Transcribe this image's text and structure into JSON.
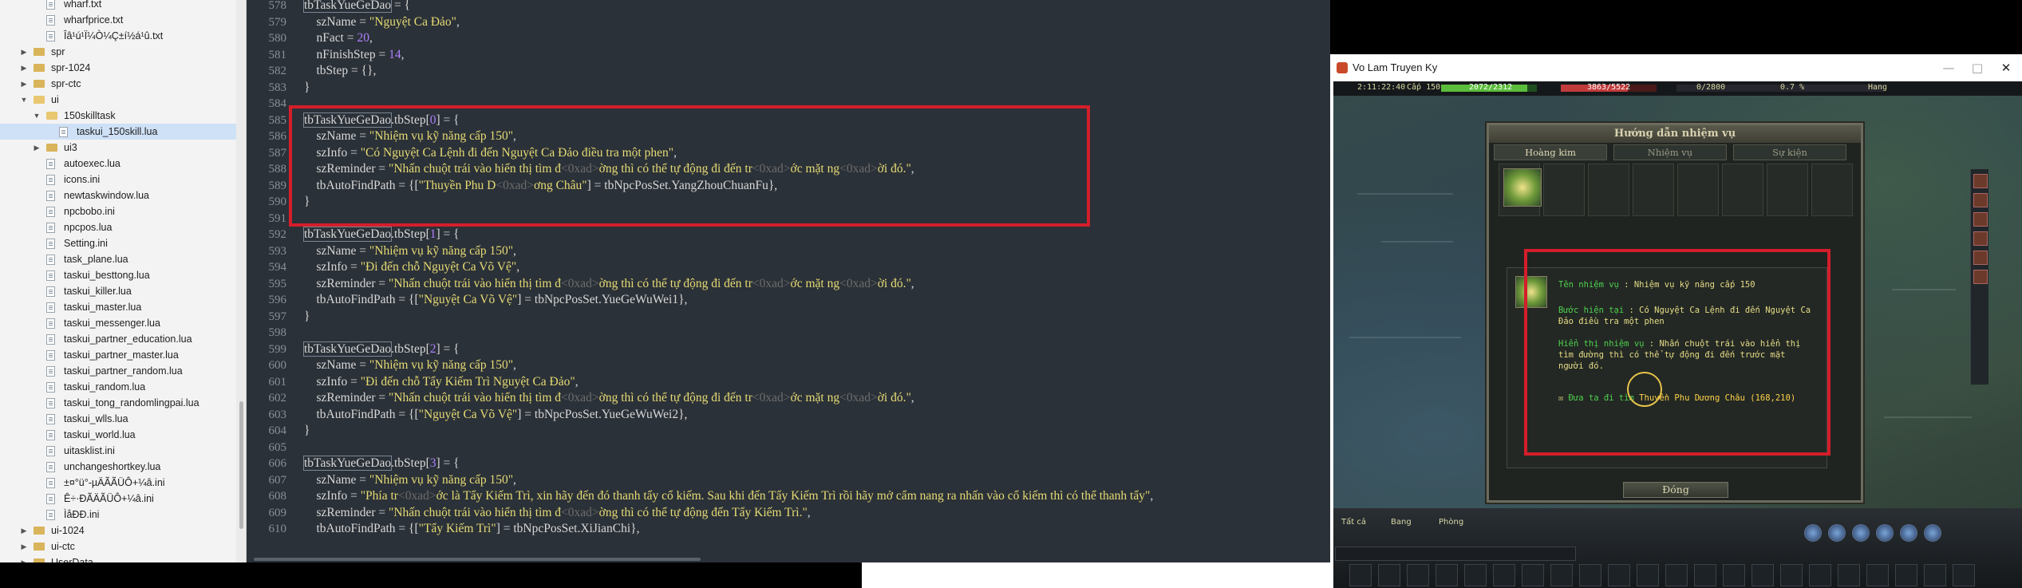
{
  "file_tree": [
    {
      "label": "wharf.txt",
      "type": "file",
      "indent": 2
    },
    {
      "label": "wharfprice.txt",
      "type": "file",
      "indent": 2
    },
    {
      "label": "Îâ¹ú¹Ï¼Ò¼Ç±í½á¹û.txt",
      "type": "file",
      "indent": 2
    },
    {
      "label": "spr",
      "type": "folder",
      "indent": 1,
      "state": "collapsed"
    },
    {
      "label": "spr-1024",
      "type": "folder",
      "indent": 1,
      "state": "collapsed"
    },
    {
      "label": "spr-ctc",
      "type": "folder",
      "indent": 1,
      "state": "collapsed"
    },
    {
      "label": "ui",
      "type": "folder",
      "indent": 1,
      "state": "expanded"
    },
    {
      "label": "150skilltask",
      "type": "folder",
      "indent": 2,
      "state": "expanded"
    },
    {
      "label": "taskui_150skill.lua",
      "type": "file",
      "indent": 3,
      "selected": true
    },
    {
      "label": "ui3",
      "type": "folder",
      "indent": 2,
      "state": "collapsed"
    },
    {
      "label": "autoexec.lua",
      "type": "file",
      "indent": 2
    },
    {
      "label": "icons.ini",
      "type": "file",
      "indent": 2
    },
    {
      "label": "newtaskwindow.lua",
      "type": "file",
      "indent": 2
    },
    {
      "label": "npcbobo.ini",
      "type": "file",
      "indent": 2
    },
    {
      "label": "npcpos.lua",
      "type": "file",
      "indent": 2
    },
    {
      "label": "Setting.ini",
      "type": "file",
      "indent": 2
    },
    {
      "label": "task_plane.lua",
      "type": "file",
      "indent": 2
    },
    {
      "label": "taskui_besttong.lua",
      "type": "file",
      "indent": 2
    },
    {
      "label": "taskui_killer.lua",
      "type": "file",
      "indent": 2
    },
    {
      "label": "taskui_master.lua",
      "type": "file",
      "indent": 2
    },
    {
      "label": "taskui_messenger.lua",
      "type": "file",
      "indent": 2
    },
    {
      "label": "taskui_partner_education.lua",
      "type": "file",
      "indent": 2
    },
    {
      "label": "taskui_partner_master.lua",
      "type": "file",
      "indent": 2
    },
    {
      "label": "taskui_partner_random.lua",
      "type": "file",
      "indent": 2
    },
    {
      "label": "taskui_random.lua",
      "type": "file",
      "indent": 2
    },
    {
      "label": "taskui_tong_randomlingpai.lua",
      "type": "file",
      "indent": 2
    },
    {
      "label": "taskui_wlls.lua",
      "type": "file",
      "indent": 2
    },
    {
      "label": "taskui_world.lua",
      "type": "file",
      "indent": 2
    },
    {
      "label": "uitasklist.ini",
      "type": "file",
      "indent": 2
    },
    {
      "label": "unchangeshortkey.lua",
      "type": "file",
      "indent": 2
    },
    {
      "label": "±¤°ü°-µÄÃÃÜÔ+¼â.ini",
      "type": "file",
      "indent": 2
    },
    {
      "label": "Ê÷·ÐÃÄÃÜÔ+¼â.ini",
      "type": "file",
      "indent": 2
    },
    {
      "label": "ÌåÐÐ.ini",
      "type": "file",
      "indent": 2
    },
    {
      "label": "ui-1024",
      "type": "folder",
      "indent": 1,
      "state": "collapsed"
    },
    {
      "label": "ui-ctc",
      "type": "folder",
      "indent": 1,
      "state": "collapsed"
    },
    {
      "label": "UserData",
      "type": "folder",
      "indent": 1,
      "state": "collapsed"
    }
  ],
  "code_lines": [
    {
      "n": "578",
      "html": "<span class='k-hl'>tbTaskYueGeDao</span> = {"
    },
    {
      "n": "579",
      "html": "    szName = <span class='k-str'>\"Nguyệt Ca Đảo\"</span>,"
    },
    {
      "n": "580",
      "html": "    nFact = <span class='k-num'>20</span>,"
    },
    {
      "n": "581",
      "html": "    nFinishStep = <span class='k-num'>14</span>,"
    },
    {
      "n": "582",
      "html": "    tbStep = {},"
    },
    {
      "n": "583",
      "html": "}"
    },
    {
      "n": "584",
      "html": ""
    },
    {
      "n": "585",
      "html": "<span class='k-hl'>tbTaskYueGeDao</span>.tbStep[<span class='k-num'>0</span>] = {"
    },
    {
      "n": "586",
      "html": "    szName = <span class='k-str'>\"Nhiệm vụ kỹ năng cấp 150\"</span>,"
    },
    {
      "n": "587",
      "html": "    szInfo = <span class='k-str'>\"Có Nguyệt Ca Lệnh đi đến Nguyệt Ca Đảo điều tra một phen\"</span>,"
    },
    {
      "n": "588",
      "html": "    szReminder = <span class='k-str'>\"Nhấn chuột trái vào hiển thị tìm đ<span class='k-esc'>&lt;0xad&gt;</span>ờng thì có thể tự động đi đến tr<span class='k-esc'>&lt;0xad&gt;</span>ớc mặt ng<span class='k-esc'>&lt;0xad&gt;</span>ời đó.\"</span>,"
    },
    {
      "n": "589",
      "html": "    tbAutoFindPath = {[<span class='k-str'>\"Thuyền Phu D<span class='k-esc'>&lt;0xad&gt;</span>ơng Châu\"</span>] = tbNpcPosSet.YangZhouChuanFu},"
    },
    {
      "n": "590",
      "html": "}"
    },
    {
      "n": "591",
      "html": ""
    },
    {
      "n": "592",
      "html": "<span class='k-hl'>tbTaskYueGeDao</span>.tbStep[<span class='k-num'>1</span>] = {"
    },
    {
      "n": "593",
      "html": "    szName = <span class='k-str'>\"Nhiệm vụ kỹ năng cấp 150\"</span>,"
    },
    {
      "n": "594",
      "html": "    szInfo = <span class='k-str'>\"Đi đến chỗ Nguyệt Ca Võ Vệ\"</span>,"
    },
    {
      "n": "595",
      "html": "    szReminder = <span class='k-str'>\"Nhấn chuột trái vào hiển thị tìm đ<span class='k-esc'>&lt;0xad&gt;</span>ờng thì có thể tự động đi đến tr<span class='k-esc'>&lt;0xad&gt;</span>ớc mặt ng<span class='k-esc'>&lt;0xad&gt;</span>ời đó.\"</span>,"
    },
    {
      "n": "596",
      "html": "    tbAutoFindPath = {[<span class='k-str'>\"Nguyệt Ca Võ Vệ\"</span>] = tbNpcPosSet.YueGeWuWei1},"
    },
    {
      "n": "597",
      "html": "}"
    },
    {
      "n": "598",
      "html": ""
    },
    {
      "n": "599",
      "html": "<span class='k-hl'>tbTaskYueGeDao</span>.tbStep[<span class='k-num'>2</span>] = {"
    },
    {
      "n": "600",
      "html": "    szName = <span class='k-str'>\"Nhiệm vụ kỹ năng cấp 150\"</span>,"
    },
    {
      "n": "601",
      "html": "    szInfo = <span class='k-str'>\"Đi đến chỗ Tẩy Kiếm Trì Nguyệt Ca Đảo\"</span>,"
    },
    {
      "n": "602",
      "html": "    szReminder = <span class='k-str'>\"Nhấn chuột trái vào hiển thị tìm đ<span class='k-esc'>&lt;0xad&gt;</span>ờng thì có thể tự động đi đến tr<span class='k-esc'>&lt;0xad&gt;</span>ớc mặt ng<span class='k-esc'>&lt;0xad&gt;</span>ời đó.\"</span>,"
    },
    {
      "n": "603",
      "html": "    tbAutoFindPath = {[<span class='k-str'>\"Nguyệt Ca Võ Vệ\"</span>] = tbNpcPosSet.YueGeWuWei2},"
    },
    {
      "n": "604",
      "html": "}"
    },
    {
      "n": "605",
      "html": ""
    },
    {
      "n": "606",
      "html": "<span class='k-hl'>tbTaskYueGeDao</span>.tbStep[<span class='k-num'>3</span>] = {"
    },
    {
      "n": "607",
      "html": "    szName = <span class='k-str'>\"Nhiệm vụ kỹ năng cấp 150\"</span>,"
    },
    {
      "n": "608",
      "html": "    szInfo = <span class='k-str'>\"Phía tr<span class='k-esc'>&lt;0xad&gt;</span>ớc là Tẩy Kiếm Trì, xin hãy đến đó thanh tẩy cổ kiếm. Sau khi đến Tẩy Kiếm Trì rồi hãy mở cẩm nang ra nhấn vào cổ kiếm thì có thể thanh tẩy\"</span>,"
    },
    {
      "n": "609",
      "html": "    szReminder = <span class='k-str'>\"Nhấn chuột trái vào hiển thị tìm đ<span class='k-esc'>&lt;0xad&gt;</span>ờng thì có thể tự động đến Tẩy Kiếm Trì.\"</span>,"
    },
    {
      "n": "610",
      "html": "    tbAutoFindPath = {[<span class='k-str'>\"Tẩy Kiếm Trì\"</span>] = tbNpcPosSet.XiJianChi},"
    }
  ],
  "game_window": {
    "title": "Vo Lam Truyen Ky",
    "minimize": "—",
    "maximize": "□",
    "close": "✕",
    "hud": {
      "time": "2:11:22:40",
      "level_label": "Cấp 150",
      "hp": "2072/2312",
      "mp": "3863/5522",
      "exp": "0/2800",
      "pct": "0.7 %",
      "rank": "Hang",
      "hp_fraction": 0.9,
      "mp_fraction": 0.7
    },
    "quest_panel": {
      "title": "Hướng dẫn nhiệm vụ",
      "tabs": [
        "Hoàng kim",
        "Nhiệm vụ",
        "Sự kiện"
      ],
      "detail": {
        "name_label": "Tên nhiệm vụ",
        "name_value": ": Nhiệm vụ kỹ năng cấp 150",
        "step_label": "Bước hiện tại",
        "step_value": ": Có Nguyệt Ca Lệnh đi đến Nguyệt Ca Đảo điều tra một phen",
        "hint_label": "Hiển thị nhiệm vụ",
        "hint_value": ": Nhấn chuột trái vào hiển thị tìm đường thì có thể tự động đi đến trước mặt người đó.",
        "goto_label": "Đưa ta đi tìm",
        "goto_value": "Thuyền Phu Dương Châu (168,210)"
      },
      "close_button": "Đóng"
    },
    "chat_tabs": [
      "Tất cả",
      "Bang",
      "Phòng"
    ]
  }
}
